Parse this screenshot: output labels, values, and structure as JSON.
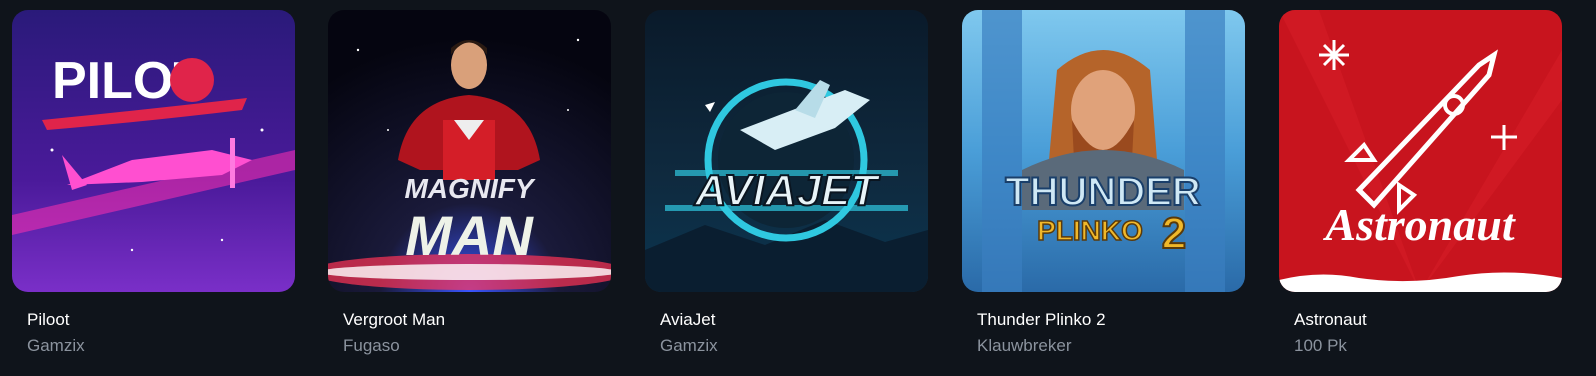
{
  "games": [
    {
      "id": "piloot",
      "title": "Piloot",
      "provider": "Gamzix",
      "logo": "PILOT"
    },
    {
      "id": "vergroot-man",
      "title": "Vergroot Man",
      "provider": "Fugaso",
      "logo_top": "MAGNIFY",
      "logo_bottom": "MAN"
    },
    {
      "id": "aviajet",
      "title": "AviaJet",
      "provider": "Gamzix",
      "logo": "AVIAJET"
    },
    {
      "id": "thunder-plinko-2",
      "title": "Thunder Plinko 2",
      "provider": "Klauwbreker",
      "logo_top": "THUNDER",
      "logo_bottom": "PLINKO",
      "logo_number": "2"
    },
    {
      "id": "astronaut",
      "title": "Astronaut",
      "provider": "100 Pk",
      "logo": "Astronaut"
    }
  ]
}
